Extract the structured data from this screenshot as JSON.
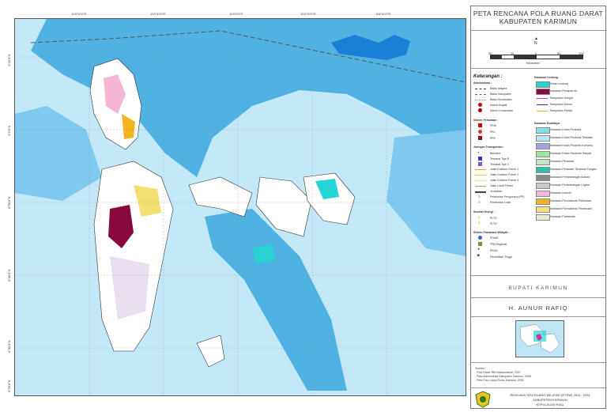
{
  "map": {
    "title_line1": "PETA RENCANA POLA RUANG DARAT",
    "title_line2": "KABUPATEN KARIMUN",
    "coords_top": [
      "103°20'0\"E",
      "103°40'0\"E",
      "104°0'0\"E",
      "104°20'0\"E",
      "104°40'0\"E"
    ],
    "coords_left": [
      "1°10'0\"N",
      "1°0'0\"N",
      "0°50'0\"N",
      "0°40'0\"N",
      "0°30'0\"N",
      "0°20'0\"N"
    ]
  },
  "scale": {
    "t0": "50",
    "t1": "25",
    "t2": "0",
    "t3": "50",
    "t4": "100",
    "unit": "Kilometer",
    "north": "N"
  },
  "legend": {
    "heading": "Keterangan :",
    "administrasi": {
      "title": "Administrasi :",
      "items": [
        "Batas Negara",
        "Batas Kabupaten",
        "Batas Kecamatan",
        "Kantor Bupati",
        "Kantor Kecamatan"
      ]
    },
    "permukiman": {
      "title": "Sistem Perkotaan :",
      "items": [
        "PKW",
        "PKL",
        "PPK"
      ]
    },
    "transportasi": {
      "title": "Jaringan Transportasi :",
      "items": [
        "Bandara",
        "Terminal Tipe B",
        "Terminal Tipe C",
        "Jalan Kolektor Primer 1",
        "Jalan Kolektor Primer 2",
        "Jalan Kolektor Primer 4",
        "Jalan Lokal Primer",
        "Jembatan",
        "Pelabuhan Pengumpul (PP)",
        "Pelabuhan Lokal"
      ]
    },
    "energi": {
      "title": "Sumber Energi :",
      "items": [
        "PLTG",
        "PLTU"
      ]
    },
    "prasarana": {
      "title": "Sistem Prasarana Wilayah :",
      "items": [
        "PDAM",
        "TPA Regional",
        "RSUD",
        "Pendidikan Tinggi"
      ]
    },
    "lindung": {
      "title": "Kawasan Lindung :",
      "items": [
        "Hutan Lindung",
        "Kawasan Resapan Air",
        "Sempadan Sungai",
        "Sempadan Danau",
        "Sempadan Pantai"
      ]
    },
    "budidaya": {
      "title": "Kawasan Budidaya :",
      "items": [
        "Kawasan Hutan Produksi",
        "Kawasan Hutan Produksi Terbatas",
        "Kawasan Hutan Produksi Konversi",
        "Kawasan Hutan Tanaman Rakyat",
        "Kawasan Pertanian",
        "Kawasan Pertanian Tanaman Pangan",
        "Kawasan Pertambangan Batuan",
        "Kawasan Pertambangan Logam",
        "Kawasan Industri",
        "Kawasan Permukiman Perkotaan",
        "Kawasan Permukiman Perdesaan",
        "Kawasan Pariwisata"
      ]
    }
  },
  "colors": {
    "sea_light": "#b9e3f5",
    "sea_deep": "#2b9ed8",
    "lake": "#1a7fd6",
    "land": "#ffffff",
    "hutan_lindung": "#27d4d4",
    "resapan": "#8b0a3e"
  },
  "signature": {
    "office": "BUPATI KARIMUN",
    "name": "H. AUNUR RAFIQ"
  },
  "sumber": {
    "title": "Sumber :",
    "line1": "- Peta Dasar RBI Bakosurtanal, 2007",
    "line2": "- Peta Administrasi Kabupaten Karimun, 2008",
    "line3": "- Peta Foto Udara Pulau Karimun, 2009"
  },
  "footer": {
    "line1": "RENCANA TATA RUANG WILAYAH (RTRW) 2011 - 2031",
    "line2": "KABUPATEN KARIMUN",
    "line3": "KEPULAUAN RIAU"
  }
}
